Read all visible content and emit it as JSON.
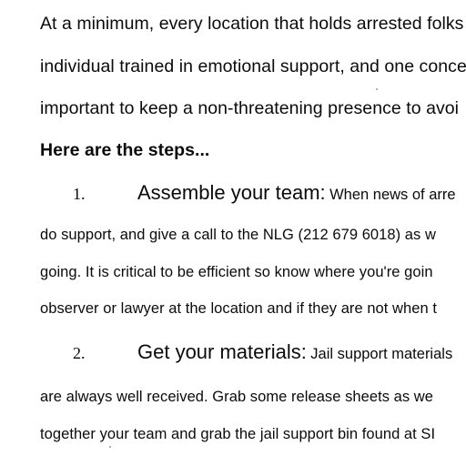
{
  "document": {
    "intro_lines": [
      "At a minimum, every location that holds arrested folks",
      "individual trained in emotional support, and one conce",
      "important to keep a non-threatening presence to avoi"
    ],
    "steps_heading": "Here are the steps...",
    "steps": [
      {
        "number": "1.",
        "title": "Assemble your team:",
        "first_line_text": "When news of arre",
        "continuation_lines": [
          "do support, and give a call to the NLG (212 679 6018) as w",
          "going.  It is critical to be efficient so know where you're goin",
          "observer or lawyer at the location and if they are not when t"
        ]
      },
      {
        "number": "2.",
        "title": "Get your materials:",
        "first_line_text": "Jail support materials",
        "continuation_lines": [
          "are always well received.  Grab some release sheets as we",
          "together your team and grab the jail support bin found at SI"
        ]
      }
    ]
  }
}
